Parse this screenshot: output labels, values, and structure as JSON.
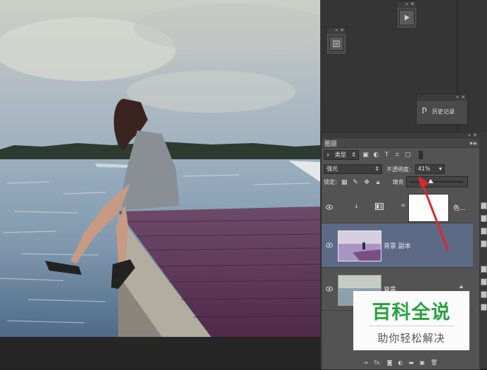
{
  "colors": {
    "arrow": "#e0262c",
    "selected_row": "#5d6a86",
    "watermark_green": "#28a341"
  },
  "top_mini_panel": {
    "icon": "play-icon"
  },
  "left_mini_panel": {
    "icon": "actions-icon"
  },
  "history_panel": {
    "label": "历史记录",
    "icon": "history-icon"
  },
  "layers": {
    "tab_label": "图层",
    "filter_kind": "类型",
    "blend_mode": "强光",
    "opacity_label": "不透明度:",
    "opacity_value": "41%",
    "lock_label": "锁定:",
    "fill_label": "填充",
    "rows": [
      {
        "name": "色...",
        "kind": "adjustment"
      },
      {
        "name": "背景 副本",
        "kind": "image",
        "selected": true
      },
      {
        "name": "背景",
        "kind": "image",
        "locked": true
      }
    ],
    "footer_fx": "fx."
  },
  "watermark": {
    "title": "百科全说",
    "subtitle": "助你轻松解决"
  }
}
